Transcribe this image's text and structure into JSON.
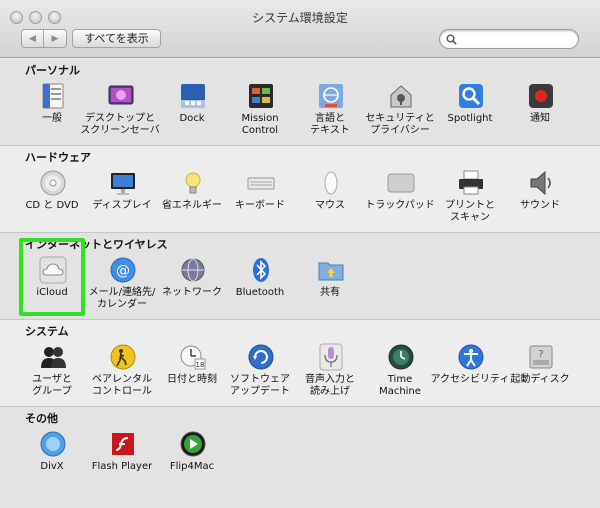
{
  "window": {
    "title": "システム環境設定",
    "show_all": "すべてを表示",
    "search_placeholder": ""
  },
  "sections": {
    "personal": {
      "title": "パーソナル",
      "items": [
        {
          "label": "一般",
          "icon": "general-icon"
        },
        {
          "label": "デスクトップと",
          "label2": "スクリーンセーバ",
          "icon": "desktop-icon"
        },
        {
          "label": "Dock",
          "icon": "dock-icon"
        },
        {
          "label": "Mission",
          "label2": "Control",
          "icon": "mission-control-icon"
        },
        {
          "label": "言語と",
          "label2": "テキスト",
          "icon": "language-icon"
        },
        {
          "label": "セキュリティと",
          "label2": "プライバシー",
          "icon": "security-icon"
        },
        {
          "label": "Spotlight",
          "icon": "spotlight-icon"
        },
        {
          "label": "通知",
          "icon": "notifications-icon"
        }
      ]
    },
    "hardware": {
      "title": "ハードウェア",
      "items": [
        {
          "label": "CD と DVD",
          "icon": "cd-dvd-icon"
        },
        {
          "label": "ディスプレイ",
          "icon": "display-icon"
        },
        {
          "label": "省エネルギー",
          "icon": "energy-saver-icon"
        },
        {
          "label": "キーボード",
          "icon": "keyboard-icon"
        },
        {
          "label": "マウス",
          "icon": "mouse-icon"
        },
        {
          "label": "トラックパッド",
          "icon": "trackpad-icon"
        },
        {
          "label": "プリントと",
          "label2": "スキャン",
          "icon": "printer-icon"
        },
        {
          "label": "サウンド",
          "icon": "sound-icon"
        }
      ]
    },
    "internet": {
      "title": "インターネットとワイヤレス",
      "items": [
        {
          "label": "iCloud",
          "icon": "icloud-icon"
        },
        {
          "label": "メール/連絡先/",
          "label2": "カレンダー",
          "icon": "mail-icon"
        },
        {
          "label": "ネットワーク",
          "icon": "network-icon"
        },
        {
          "label": "Bluetooth",
          "icon": "bluetooth-icon"
        },
        {
          "label": "共有",
          "icon": "sharing-icon"
        }
      ]
    },
    "system": {
      "title": "システム",
      "items": [
        {
          "label": "ユーザと",
          "label2": "グループ",
          "icon": "users-icon"
        },
        {
          "label": "ペアレンタル",
          "label2": "コントロール",
          "icon": "parental-icon"
        },
        {
          "label": "日付と時刻",
          "icon": "date-time-icon"
        },
        {
          "label": "ソフトウェア",
          "label2": "アップデート",
          "icon": "software-update-icon"
        },
        {
          "label": "音声入力と",
          "label2": "読み上げ",
          "icon": "dictation-icon"
        },
        {
          "label": "Time",
          "label2": "Machine",
          "icon": "time-machine-icon"
        },
        {
          "label": "アクセシビリティ",
          "icon": "accessibility-icon"
        },
        {
          "label": "起動ディスク",
          "icon": "startup-disk-icon"
        }
      ]
    },
    "other": {
      "title": "その他",
      "items": [
        {
          "label": "DivX",
          "icon": "divx-icon"
        },
        {
          "label": "Flash Player",
          "icon": "flash-icon"
        },
        {
          "label": "Flip4Mac",
          "icon": "flip4mac-icon"
        }
      ]
    }
  },
  "colors": {
    "highlight": "#32e021"
  }
}
